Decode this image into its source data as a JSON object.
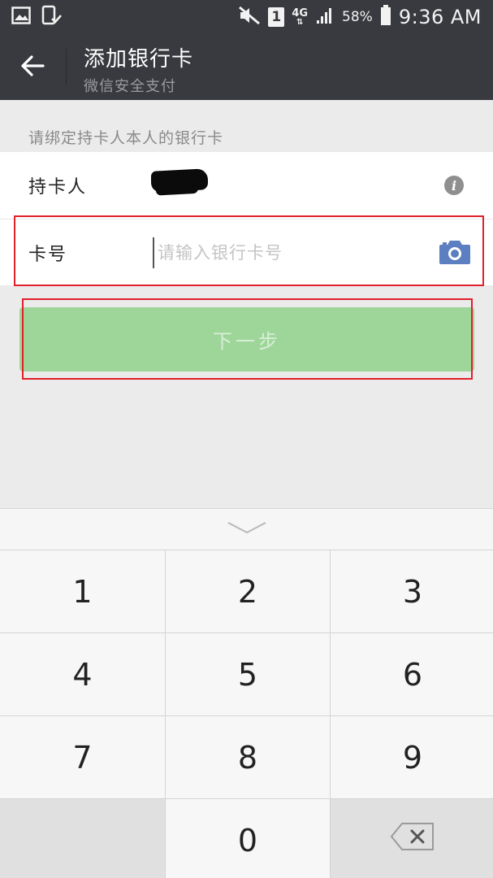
{
  "status_bar": {
    "battery_percent": "58%",
    "network": "4G",
    "sim_slot": "1",
    "time": "9:36 AM"
  },
  "header": {
    "title": "添加银行卡",
    "subtitle": "微信安全支付"
  },
  "form": {
    "hint": "请绑定持卡人本人的银行卡",
    "holder_label": "持卡人",
    "card_label": "卡号",
    "card_placeholder": "请输入银行卡号",
    "card_value": ""
  },
  "next_button": {
    "label": "下一步",
    "enabled": false
  },
  "keypad": {
    "keys": [
      "1",
      "2",
      "3",
      "4",
      "5",
      "6",
      "7",
      "8",
      "9",
      "",
      "0",
      "⌫"
    ]
  },
  "colors": {
    "header_bg": "#393a3f",
    "button_disabled_green": "#9ed69a",
    "camera_blue": "#5b7fc0",
    "highlight_red": "#e0202a"
  },
  "icons": [
    "gallery-icon",
    "phone-check-icon",
    "mute-icon",
    "signal-icon",
    "battery-icon",
    "back-arrow-icon",
    "info-icon",
    "camera-icon",
    "chevron-down-icon",
    "backspace-icon"
  ]
}
